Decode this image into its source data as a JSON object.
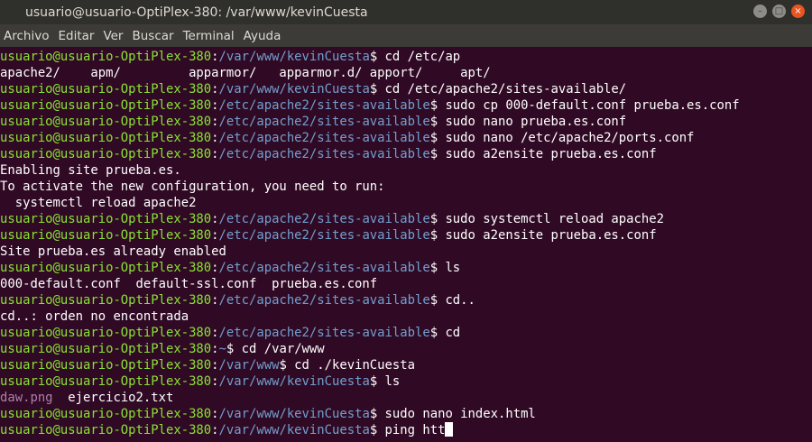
{
  "window": {
    "title": "usuario@usuario-OptiPlex-380: /var/www/kevinCuesta",
    "buttons": {
      "minimize": "–",
      "maximize": "□",
      "close": "×"
    }
  },
  "menu": [
    "Archivo",
    "Editar",
    "Ver",
    "Buscar",
    "Terminal",
    "Ayuda"
  ],
  "colors": {
    "background": "#300a24",
    "user": "#8ae234",
    "path": "#729fcf",
    "image_file": "#ad7fa8",
    "text": "#ffffff"
  },
  "terminal": {
    "lines": [
      {
        "segments": [
          {
            "t": "usuario@usuario-OptiPlex-380",
            "c": "u"
          },
          {
            "t": ":"
          },
          {
            "t": "/var/www/kevinCuesta",
            "c": "p"
          },
          {
            "t": "$ cd /etc/ap"
          }
        ]
      },
      {
        "segments": [
          {
            "t": "apache2/    apm/         apparmor/   apparmor.d/ apport/     apt/"
          }
        ]
      },
      {
        "segments": [
          {
            "t": "usuario@usuario-OptiPlex-380",
            "c": "u"
          },
          {
            "t": ":"
          },
          {
            "t": "/var/www/kevinCuesta",
            "c": "p"
          },
          {
            "t": "$ cd /etc/apache2/sites-available/"
          }
        ]
      },
      {
        "segments": [
          {
            "t": "usuario@usuario-OptiPlex-380",
            "c": "u"
          },
          {
            "t": ":"
          },
          {
            "t": "/etc/apache2/sites-available",
            "c": "p"
          },
          {
            "t": "$ sudo cp 000-default.conf prueba.es.conf"
          }
        ]
      },
      {
        "segments": [
          {
            "t": "usuario@usuario-OptiPlex-380",
            "c": "u"
          },
          {
            "t": ":"
          },
          {
            "t": "/etc/apache2/sites-available",
            "c": "p"
          },
          {
            "t": "$ sudo nano prueba.es.conf"
          }
        ]
      },
      {
        "segments": [
          {
            "t": "usuario@usuario-OptiPlex-380",
            "c": "u"
          },
          {
            "t": ":"
          },
          {
            "t": "/etc/apache2/sites-available",
            "c": "p"
          },
          {
            "t": "$ sudo nano /etc/apache2/ports.conf"
          }
        ]
      },
      {
        "segments": [
          {
            "t": "usuario@usuario-OptiPlex-380",
            "c": "u"
          },
          {
            "t": ":"
          },
          {
            "t": "/etc/apache2/sites-available",
            "c": "p"
          },
          {
            "t": "$ sudo a2ensite prueba.es.conf"
          }
        ]
      },
      {
        "segments": [
          {
            "t": "Enabling site prueba.es."
          }
        ]
      },
      {
        "segments": [
          {
            "t": "To activate the new configuration, you need to run:"
          }
        ]
      },
      {
        "segments": [
          {
            "t": "  systemctl reload apache2"
          }
        ]
      },
      {
        "segments": [
          {
            "t": "usuario@usuario-OptiPlex-380",
            "c": "u"
          },
          {
            "t": ":"
          },
          {
            "t": "/etc/apache2/sites-available",
            "c": "p"
          },
          {
            "t": "$ sudo systemctl reload apache2"
          }
        ]
      },
      {
        "segments": [
          {
            "t": "usuario@usuario-OptiPlex-380",
            "c": "u"
          },
          {
            "t": ":"
          },
          {
            "t": "/etc/apache2/sites-available",
            "c": "p"
          },
          {
            "t": "$ sudo a2ensite prueba.es.conf"
          }
        ]
      },
      {
        "segments": [
          {
            "t": "Site prueba.es already enabled"
          }
        ]
      },
      {
        "segments": [
          {
            "t": "usuario@usuario-OptiPlex-380",
            "c": "u"
          },
          {
            "t": ":"
          },
          {
            "t": "/etc/apache2/sites-available",
            "c": "p"
          },
          {
            "t": "$ ls"
          }
        ]
      },
      {
        "segments": [
          {
            "t": "000-default.conf  default-ssl.conf  prueba.es.conf"
          }
        ]
      },
      {
        "segments": [
          {
            "t": "usuario@usuario-OptiPlex-380",
            "c": "u"
          },
          {
            "t": ":"
          },
          {
            "t": "/etc/apache2/sites-available",
            "c": "p"
          },
          {
            "t": "$ cd.."
          }
        ]
      },
      {
        "segments": [
          {
            "t": "cd..: orden no encontrada"
          }
        ]
      },
      {
        "segments": [
          {
            "t": "usuario@usuario-OptiPlex-380",
            "c": "u"
          },
          {
            "t": ":"
          },
          {
            "t": "/etc/apache2/sites-available",
            "c": "p"
          },
          {
            "t": "$ cd"
          }
        ]
      },
      {
        "segments": [
          {
            "t": "usuario@usuario-OptiPlex-380",
            "c": "u"
          },
          {
            "t": ":"
          },
          {
            "t": "~",
            "c": "p"
          },
          {
            "t": "$ cd /var/www"
          }
        ]
      },
      {
        "segments": [
          {
            "t": "usuario@usuario-OptiPlex-380",
            "c": "u"
          },
          {
            "t": ":"
          },
          {
            "t": "/var/www",
            "c": "p"
          },
          {
            "t": "$ cd ./kevinCuesta"
          }
        ]
      },
      {
        "segments": [
          {
            "t": "usuario@usuario-OptiPlex-380",
            "c": "u"
          },
          {
            "t": ":"
          },
          {
            "t": "/var/www/kevinCuesta",
            "c": "p"
          },
          {
            "t": "$ ls"
          }
        ]
      },
      {
        "segments": [
          {
            "t": "daw.png",
            "c": "img"
          },
          {
            "t": "  ejercicio2.txt"
          }
        ]
      },
      {
        "segments": [
          {
            "t": "usuario@usuario-OptiPlex-380",
            "c": "u"
          },
          {
            "t": ":"
          },
          {
            "t": "/var/www/kevinCuesta",
            "c": "p"
          },
          {
            "t": "$ sudo nano index.html"
          }
        ]
      },
      {
        "segments": [
          {
            "t": "usuario@usuario-OptiPlex-380",
            "c": "u"
          },
          {
            "t": ":"
          },
          {
            "t": "/var/www/kevinCuesta",
            "c": "p"
          },
          {
            "t": "$ ping htt"
          }
        ],
        "cursor": true
      }
    ]
  }
}
